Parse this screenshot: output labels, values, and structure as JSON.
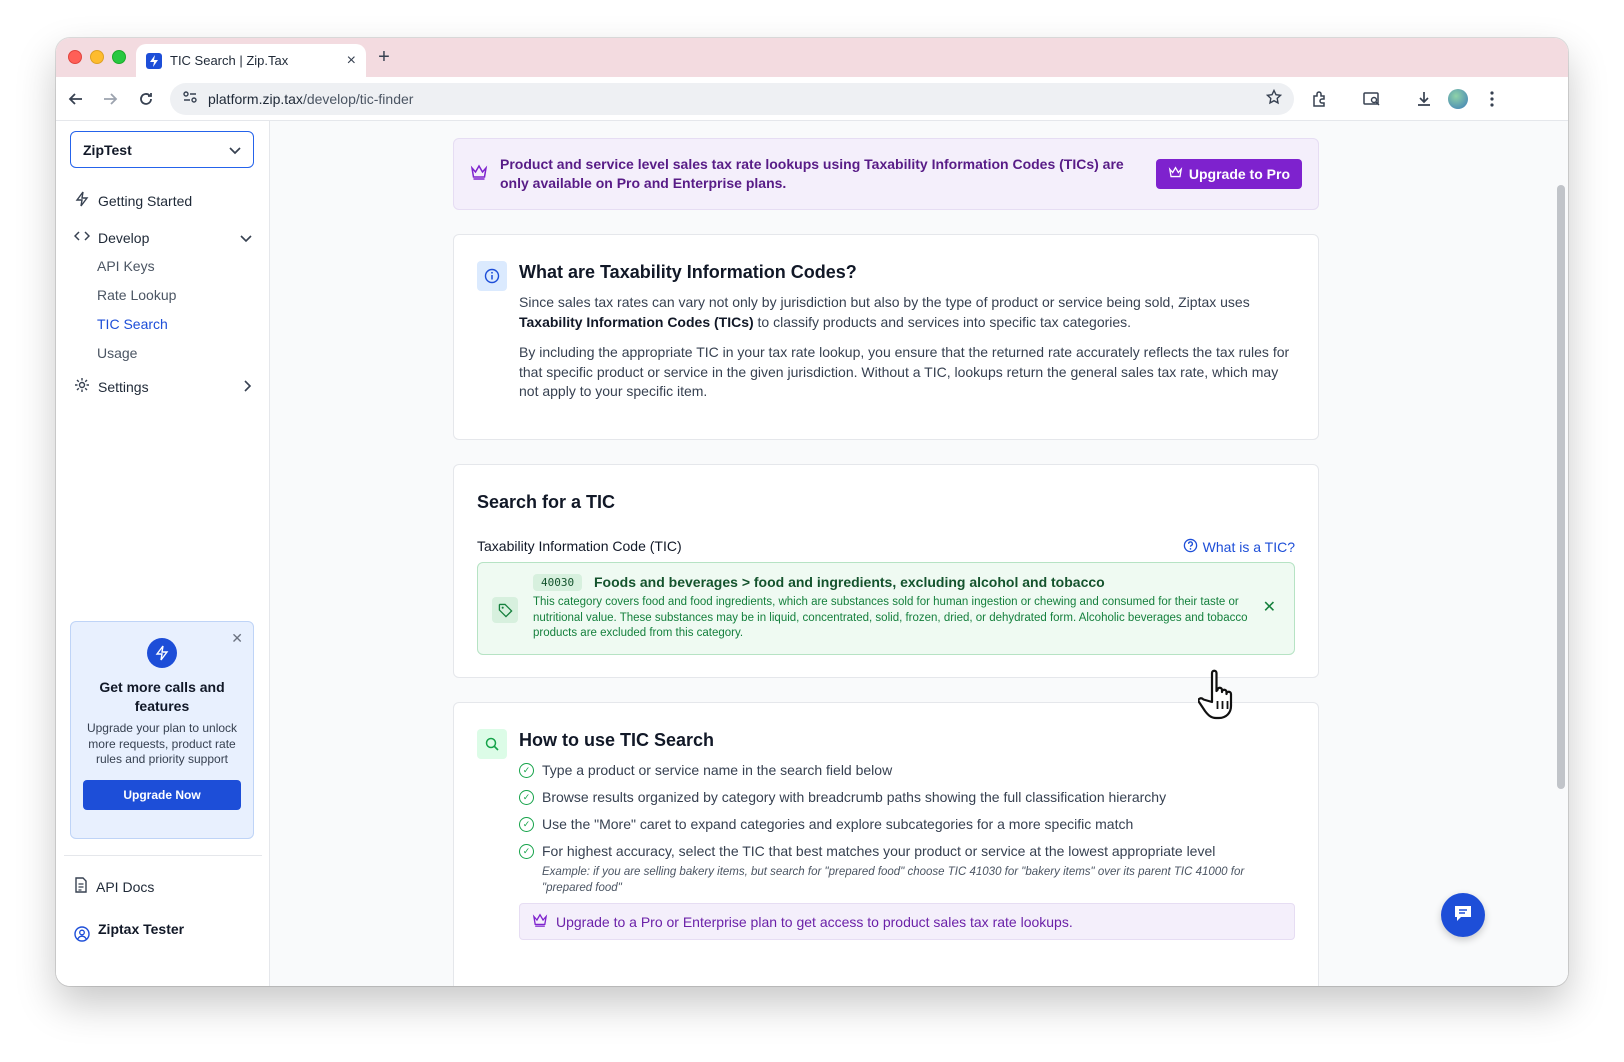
{
  "browser": {
    "tab_title": "TIC Search | Zip.Tax",
    "url_host": "platform.zip.tax",
    "url_path": "/develop/tic-finder"
  },
  "sidebar": {
    "org_selector": "ZipTest",
    "nav": {
      "getting_started": "Getting Started",
      "develop": "Develop",
      "settings": "Settings"
    },
    "develop_items": [
      "API Keys",
      "Rate Lookup",
      "TIC Search",
      "Usage"
    ],
    "active_item": "TIC Search",
    "promo": {
      "title": "Get more calls and features",
      "text": "Upgrade your plan to unlock more requests, product rate rules and priority support",
      "button": "Upgrade Now"
    },
    "footer": {
      "api_docs": "API Docs",
      "user_name": "Ziptax Tester"
    }
  },
  "banner": {
    "text": "Product and service level sales tax rate lookups using Taxability Information Codes (TICs) are only available on Pro and Enterprise plans.",
    "button": "Upgrade to Pro"
  },
  "what_card": {
    "title": "What are Taxability Information Codes?",
    "p1_before": "Since sales tax rates can vary not only by jurisdiction but also by the type of product or service being sold, Ziptax uses ",
    "p1_bold": "Taxability Information Codes (TICs)",
    "p1_after": " to classify products and services into specific tax categories.",
    "p2": "By including the appropriate TIC in your tax rate lookup, you ensure that the returned rate accurately reflects the tax rules for that specific product or service in the given jurisdiction. Without a TIC, lookups return the general sales tax rate, which may not apply to your specific item."
  },
  "search_card": {
    "title": "Search for a TIC",
    "field_label": "Taxability Information Code (TIC)",
    "help_link": "What is a TIC?",
    "selected": {
      "code": "40030",
      "name": "Foods and beverages > food and ingredients, excluding alcohol and tobacco",
      "description": "This category covers food and food ingredients, which are substances sold for human ingestion or chewing and consumed for their taste or nutritional value. These substances may be in liquid, concentrated, solid, frozen, dried, or dehydrated form. Alcoholic beverages and tobacco products are excluded from this category."
    }
  },
  "how_card": {
    "title": "How to use TIC Search",
    "steps": [
      "Type a product or service name in the search field below",
      "Browse results organized by category with breadcrumb paths showing the full classification hierarchy",
      "Use the \"More\" caret to expand categories and explore subcategories for a more specific match",
      "For highest accuracy, select the TIC that best matches your product or service at the lowest appropriate level"
    ],
    "example": "Example: if you are selling bakery items, but search for \"prepared food\" choose TIC 41030 for \"bakery items\" over its parent TIC 41000 for \"prepared food\"",
    "upgrade_notice": "Upgrade to a Pro or Enterprise plan to get access to product sales tax rate lookups."
  },
  "colors": {
    "brand_blue": "#1d4ed8",
    "purple_accent": "#7e22ce",
    "success_green": "#16a34a",
    "tab_strip": "#f3dbe0"
  },
  "icons": [
    "zip-tax-favicon",
    "back-arrow-icon",
    "forward-arrow-icon",
    "reload-icon",
    "site-info-icon",
    "bookmark-star-icon",
    "extensions-icon",
    "tab-search-icon",
    "download-icon",
    "profile-avatar-icon",
    "kebab-menu-icon",
    "bolt-icon",
    "code-icon",
    "gear-icon",
    "crown-icon",
    "info-icon",
    "tag-icon",
    "search-icon",
    "check-circle-icon",
    "question-icon",
    "document-icon",
    "user-circle-icon",
    "chat-icon",
    "hand-cursor-icon"
  ]
}
